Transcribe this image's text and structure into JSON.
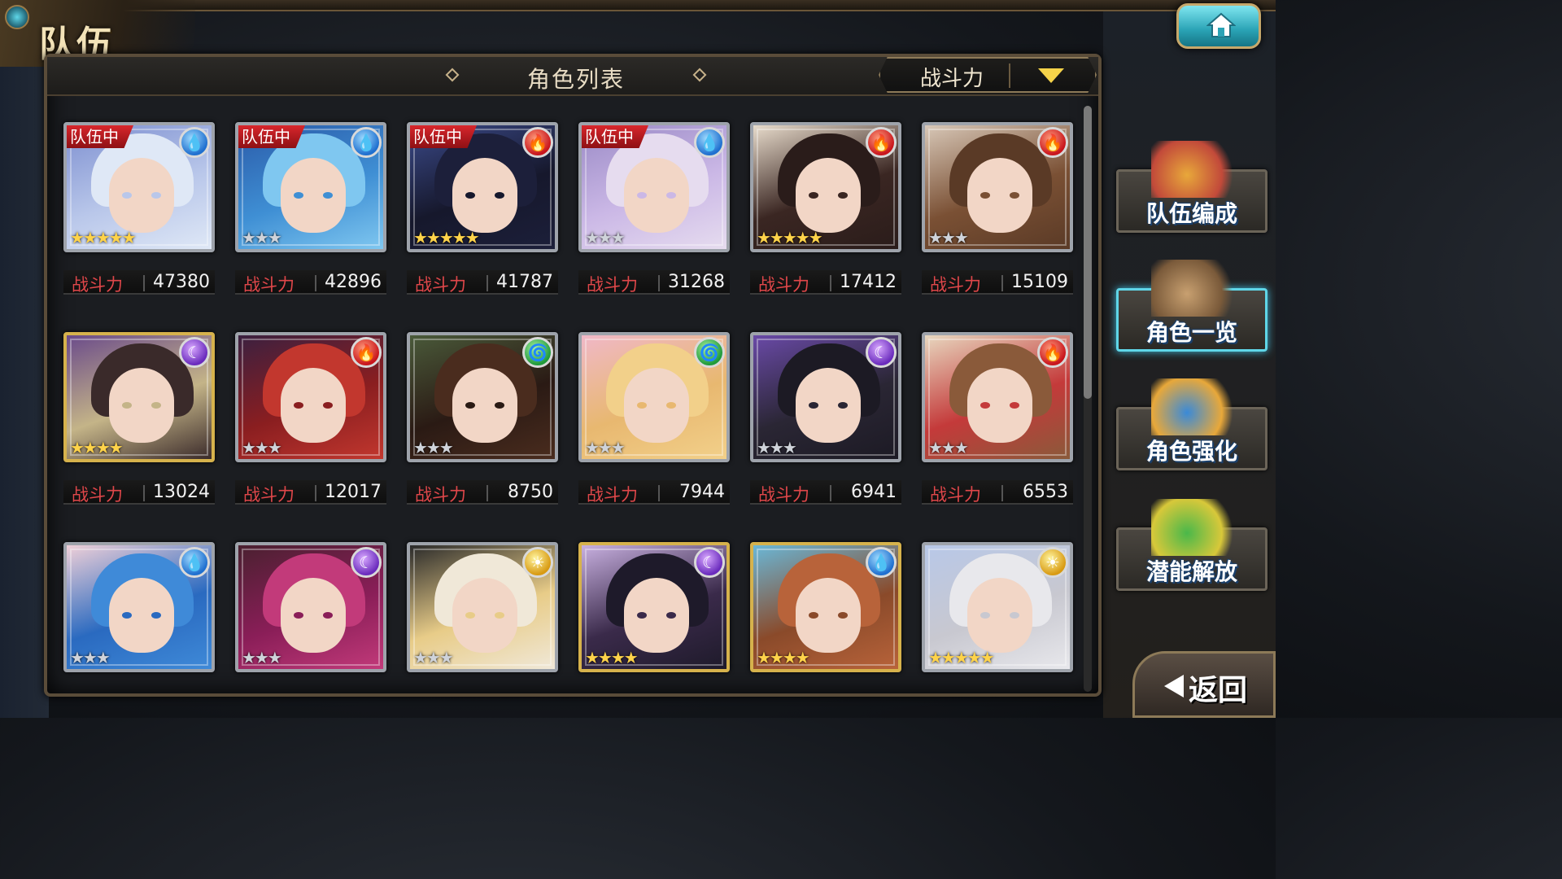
{
  "header": {
    "title": "队伍",
    "home_icon": "home-icon"
  },
  "panel": {
    "title": "角色列表",
    "sort_label": "战斗力",
    "sort_dropdown_icon": "triangle-down-icon"
  },
  "colors": {
    "accent_cyan": "#5fd6e8",
    "power_label_red": "#e0474a",
    "team_badge_red": "#d8262c",
    "gold_frame": "#d6b24c",
    "dropdown_arrow": "#f5d34a"
  },
  "team_badge_label": "队伍中",
  "power_label": "战斗力",
  "characters": [
    {
      "in_team": true,
      "element": "water",
      "stars": 5,
      "frame": "silver",
      "power": "47380",
      "palette": [
        "#dfe8f6",
        "#b9c7ea",
        "#7d8fd0"
      ]
    },
    {
      "in_team": true,
      "element": "water",
      "stars": 3,
      "frame": "silver",
      "power": "42896",
      "palette": [
        "#7fc7f0",
        "#3f8fd4",
        "#2a5aa8"
      ]
    },
    {
      "in_team": true,
      "element": "fire",
      "stars": 5,
      "frame": "silver",
      "power": "41787",
      "palette": [
        "#1c1f3a",
        "#16182c",
        "#3b4a8a"
      ]
    },
    {
      "in_team": true,
      "element": "water",
      "stars": 3,
      "frame": "silver",
      "power": "31268",
      "palette": [
        "#e6dcef",
        "#cbb8e6",
        "#9a8ac6"
      ]
    },
    {
      "in_team": false,
      "element": "fire",
      "stars": 5,
      "frame": "silver",
      "power": "17412",
      "palette": [
        "#2a1c1a",
        "#3a2622",
        "#e8dccc"
      ]
    },
    {
      "in_team": false,
      "element": "fire",
      "stars": 3,
      "frame": "silver",
      "power": "15109",
      "palette": [
        "#5a3a26",
        "#7a5034",
        "#d8c8b8"
      ]
    },
    {
      "in_team": false,
      "element": "dark",
      "stars": 4,
      "frame": "gold",
      "power": "13024",
      "palette": [
        "#3a2a2a",
        "#c4b488",
        "#6a4a8a"
      ]
    },
    {
      "in_team": false,
      "element": "fire",
      "stars": 3,
      "frame": "silver",
      "power": "12017",
      "palette": [
        "#c2372e",
        "#8a1e20",
        "#3b2040"
      ]
    },
    {
      "in_team": false,
      "element": "wind",
      "stars": 3,
      "frame": "silver",
      "power": "8750",
      "palette": [
        "#4a2c1e",
        "#2a1a14",
        "#4a5a3a"
      ]
    },
    {
      "in_team": false,
      "element": "wind",
      "stars": 3,
      "frame": "silver",
      "power": "7944",
      "palette": [
        "#f2d08a",
        "#e8b870",
        "#f0b8c8"
      ]
    },
    {
      "in_team": false,
      "element": "dark",
      "stars": 3,
      "frame": "silver",
      "power": "6941",
      "palette": [
        "#1c1a24",
        "#2a2634",
        "#6a4aa8"
      ]
    },
    {
      "in_team": false,
      "element": "fire",
      "stars": 3,
      "frame": "silver",
      "power": "6553",
      "palette": [
        "#8a5a3a",
        "#c43a3a",
        "#e8d8c0"
      ]
    },
    {
      "in_team": false,
      "element": "water",
      "stars": 3,
      "frame": "silver",
      "power": "",
      "palette": [
        "#3f8ad8",
        "#2a6ac0",
        "#f0d0d8"
      ]
    },
    {
      "in_team": false,
      "element": "dark",
      "stars": 3,
      "frame": "silver",
      "power": "",
      "palette": [
        "#c23a7a",
        "#8a1e58",
        "#4a2030"
      ]
    },
    {
      "in_team": false,
      "element": "light",
      "stars": 3,
      "frame": "silver",
      "power": "",
      "palette": [
        "#f0e8d8",
        "#e8cc88",
        "#2a2a2a"
      ]
    },
    {
      "in_team": false,
      "element": "dark",
      "stars": 4,
      "frame": "gold",
      "power": "",
      "palette": [
        "#1e1a2a",
        "#3a2a4a",
        "#c8b0e0"
      ]
    },
    {
      "in_team": false,
      "element": "water",
      "stars": 4,
      "frame": "gold",
      "power": "",
      "palette": [
        "#b8633a",
        "#8a4a2a",
        "#6ab8d8"
      ]
    },
    {
      "in_team": false,
      "element": "light",
      "stars": 5,
      "frame": "silver",
      "power": "",
      "palette": [
        "#e8e8ec",
        "#c8c8d0",
        "#b8c8e8"
      ]
    }
  ],
  "side_menu": [
    {
      "label": "队伍编成",
      "icon": "team-formation-icon",
      "active": false
    },
    {
      "label": "角色一览",
      "icon": "character-book-icon",
      "active": true
    },
    {
      "label": "角色强化",
      "icon": "character-upgrade-icon",
      "active": false
    },
    {
      "label": "潜能解放",
      "icon": "potential-release-icon",
      "active": false
    }
  ],
  "back": {
    "label": "返回",
    "icon": "back-arrow-icon"
  }
}
